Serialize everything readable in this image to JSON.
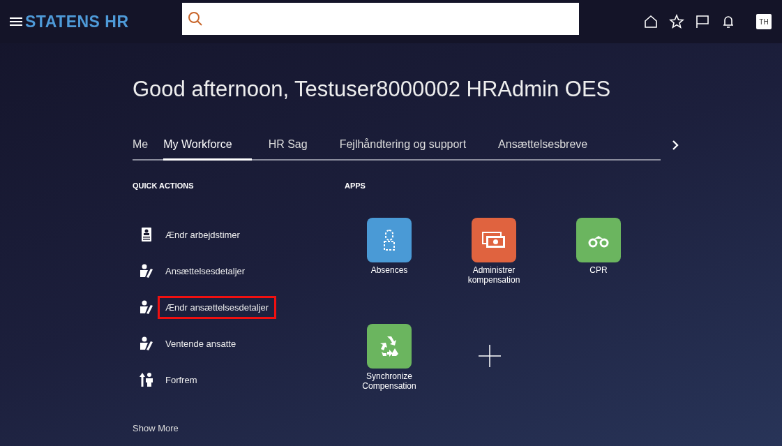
{
  "header": {
    "logo": "STATENS HR",
    "avatar": "TH"
  },
  "greeting": "Good afternoon, Testuser8000002 HRAdmin OES",
  "tabs": [
    {
      "label": "Me",
      "selected": false
    },
    {
      "label": "My Workforce",
      "selected": true
    },
    {
      "label": "HR Sag",
      "selected": false
    },
    {
      "label": "Fejlhåndtering og support",
      "selected": false
    },
    {
      "label": "Ansættelsesbreve",
      "selected": false
    }
  ],
  "quick_actions": {
    "title": "QUICK ACTIONS",
    "items": [
      {
        "label": "Ændr arbejdstimer",
        "kind": "badge",
        "highlighted": false
      },
      {
        "label": "Ansættelsesdetaljer",
        "kind": "edit",
        "highlighted": false
      },
      {
        "label": "Ændr ansættelsesdetaljer",
        "kind": "edit",
        "highlighted": true
      },
      {
        "label": "Ventende ansatte",
        "kind": "edit",
        "highlighted": false
      },
      {
        "label": "Forfrem",
        "kind": "promote",
        "highlighted": false
      }
    ],
    "show_more": "Show More"
  },
  "apps": {
    "title": "APPS",
    "items": [
      {
        "label": "Absences",
        "kind": "person",
        "color": "#4a9ad6"
      },
      {
        "label": "Administrer kompensation",
        "kind": "money",
        "color": "#e0633f"
      },
      {
        "label": "CPR",
        "kind": "binoculars",
        "color": "#6bb55f"
      },
      {
        "label": "Synchronize Compensation",
        "kind": "recycle",
        "color": "#6bb55f"
      }
    ]
  }
}
